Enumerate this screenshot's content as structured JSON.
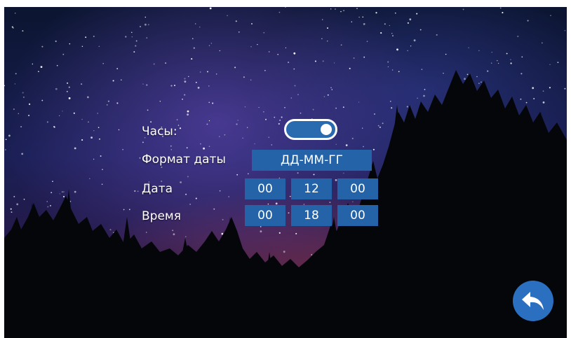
{
  "settings": {
    "clock": {
      "label": "Часы:",
      "enabled": true
    },
    "date_format": {
      "label": "Формат даты",
      "value": "ДД-ММ-ГГ"
    },
    "date": {
      "label": "Дата",
      "day": "00",
      "month": "12",
      "year": "00"
    },
    "time": {
      "label": "Время",
      "hours": "00",
      "minutes": "18",
      "seconds": "00"
    }
  },
  "colors": {
    "field_bg": "#2563a8",
    "toggle_bg": "#2a6bb0",
    "back_button": "#2b6fc0"
  },
  "icons": {
    "back": "back-arrow-icon"
  }
}
